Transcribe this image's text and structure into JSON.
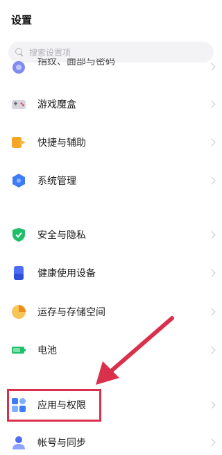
{
  "header": {
    "title": "设置"
  },
  "search": {
    "placeholder": "搜索设置项"
  },
  "items": [
    {
      "label": "指纹、面部与密码",
      "icon": "fingerprint-icon"
    },
    {
      "label": "游戏魔盒",
      "icon": "game-box-icon"
    },
    {
      "label": "快捷与辅助",
      "icon": "shortcut-icon"
    },
    {
      "label": "系统管理",
      "icon": "system-management-icon"
    },
    {
      "label": "安全与隐私",
      "icon": "shield-icon"
    },
    {
      "label": "健康使用设备",
      "icon": "health-icon"
    },
    {
      "label": "运存与存储空间",
      "icon": "storage-icon"
    },
    {
      "label": "电池",
      "icon": "battery-icon"
    },
    {
      "label": "应用与权限",
      "icon": "apps-icon"
    },
    {
      "label": "帐号与同步",
      "icon": "account-icon"
    }
  ],
  "colors": {
    "annotation_red": "#d9314b",
    "accent_blue": "#3d7bf7",
    "green": "#1fbf69",
    "orange": "#f5a623"
  }
}
